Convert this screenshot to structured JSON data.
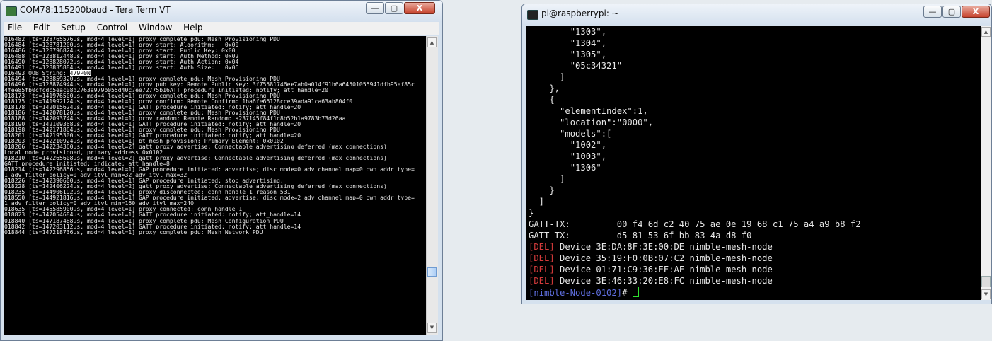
{
  "teraterm": {
    "title": "COM78:115200baud - Tera Term VT",
    "controls": {
      "minimize": "—",
      "maximize": "▢",
      "close": "X"
    },
    "menu": [
      "File",
      "Edit",
      "Setup",
      "Control",
      "Window",
      "Help"
    ],
    "lines": [
      "016482 [ts=128765576us, mod=4 level=1] proxy_complete_pdu: Mesh Provisioning PDU",
      "016484 [ts=128781200us, mod=4 level=1] prov_start: Algorithm:   0x00",
      "016486 [ts=128796824us, mod=4 level=1] prov_start: Public Key: 0x00",
      "016488 [ts=128812448us, mod=4 level=1] prov_start: Auth Method: 0x02",
      "016490 [ts=128828072us, mod=4 level=1] prov_start: Auth Action: 0x04",
      "016491 [ts=128835884us, mod=4 level=1] prov_start: Auth Size:   0x06",
      "016493 OOB String: ",
      "016494 [ts=128859320us, mod=4 level=1] proxy_complete_pdu: Mesh Provisioning PDU",
      "016496 [ts=128874944us, mod=4 level=1] prov_pub_key: Remote Public Key: 3f75581746ee7ab0a014f91b6a64501055941dfb95ef85c",
      "4fee85fb0cfcdc5eac08d2763a979b055d40c7ee72775b16ATT procedure initiated: notify; att_handle=20",
      "018173 [ts=141976500us, mod=4 level=1] proxy_complete_pdu: Mesh Provisioning PDU",
      "018175 [ts=141992124us, mod=4 level=1] prov_confirm: Remote Confirm: 1ba6fe66128cce39ada91ca63ab804f0",
      "018178 [ts=142015624us, mod=4 level=1] GATT procedure initiated: notify; att_handle=20",
      "018186 [ts=142078120us, mod=4 level=1] proxy_complete_pdu: Mesh Provisioning PDU",
      "018188 [ts=142093744us, mod=4 level=1] prov_random: Remote Random: a237145f84f1c8b52b1a9783b73d26aa",
      "018190 [ts=142109368us, mod=4 level=1] GATT procedure initiated: notify; att_handle=20",
      "018198 [ts=142171864us, mod=4 level=1] proxy_complete_pdu: Mesh Provisioning PDU",
      "018201 [ts=142195300us, mod=4 level=1] GATT procedure initiated: notify; att_handle=20",
      "018203 [ts=142210924us, mod=4 level=1] bt_mesh_provision: Primary Element: 0x0102",
      "018206 [ts=142234360us, mod=4 level=2] gatt_proxy_advertise: Connectable advertising deferred (max connections)",
      "Local node provisioned, primary address 0x0102",
      "018210 [ts=142265608us, mod=4 level=2] gatt_proxy_advertise: Connectable advertising deferred (max connections)",
      "GATT procedure initiated: indicate; att_handle=8",
      "018214 [ts=142296856us, mod=4 level=1] GAP procedure initiated: advertise; disc_mode=0 adv_channel_map=0 own_addr_type=",
      "1 adv_filter_policy=0 adv_itvl_min=32 adv_itvl_max=32",
      "018226 [ts=142390600us, mod=4 level=1] GAP procedure initiated: stop advertising.",
      "018228 [ts=142406224us, mod=4 level=2] gatt_proxy_advertise: Connectable advertising deferred (max connections)",
      "018235 [ts=144906192us, mod=4 level=1] proxy_disconnected: conn_handle 1 reason 531",
      "018550 [ts=144921816us, mod=4 level=1] GAP procedure initiated: advertise; disc_mode=2 adv_channel_map=0 own_addr_type=",
      "1 adv_filter_policy=0 adv_itvl_min=160 adv_itvl_max=240",
      "018635 [ts=145585900us, mod=4 level=1] proxy_connected: conn_handle 1",
      "018823 [ts=147054684us, mod=4 level=1] GATT procedure initiated: notify; att_handle=14",
      "018840 [ts=147187488us, mod=4 level=1] proxy_complete_pdu: Mesh Configuration PDU",
      "018842 [ts=147203112us, mod=4 level=1] GATT procedure initiated: notify; att_handle=14",
      "018844 [ts=147218736us, mod=4 level=1] proxy_complete_pdu: Mesh Network PDU"
    ],
    "oob_value": "479P0N"
  },
  "pi": {
    "title": "pi@raspberrypi: ~",
    "controls": {
      "minimize": "—",
      "maximize": "▢",
      "close": "X"
    },
    "json_lines": [
      "        \"1303\",",
      "        \"1304\",",
      "        \"1305\",",
      "        \"05c34321\"",
      "      ]",
      "    },",
      "    {",
      "      \"elementIndex\":1,",
      "      \"location\":\"0000\",",
      "      \"models\":[",
      "        \"1002\",",
      "        \"1003\",",
      "        \"1306\"",
      "      ]",
      "    }",
      "  ]",
      "}"
    ],
    "gatt_lines": [
      "GATT-TX:         00 f4 6d c2 40 75 ae 0e 19 68 c1 75 a4 a9 b8 f2",
      "GATT-TX:         d5 81 53 6f bb 83 4a d8 f0"
    ],
    "del_lines": [
      {
        "tag": "[DEL]",
        "text": " Device 3E:DA:8F:3E:00:DE nimble-mesh-node"
      },
      {
        "tag": "[DEL]",
        "text": " Device 35:19:F0:0B:07:C2 nimble-mesh-node"
      },
      {
        "tag": "[DEL]",
        "text": " Device 01:71:C9:36:EF:AF nimble-mesh-node"
      },
      {
        "tag": "[DEL]",
        "text": " Device 3E:46:33:20:E8:FC nimble-mesh-node"
      }
    ],
    "prompt": "[nimble-Node-0102]",
    "prompt_suffix": "# "
  }
}
